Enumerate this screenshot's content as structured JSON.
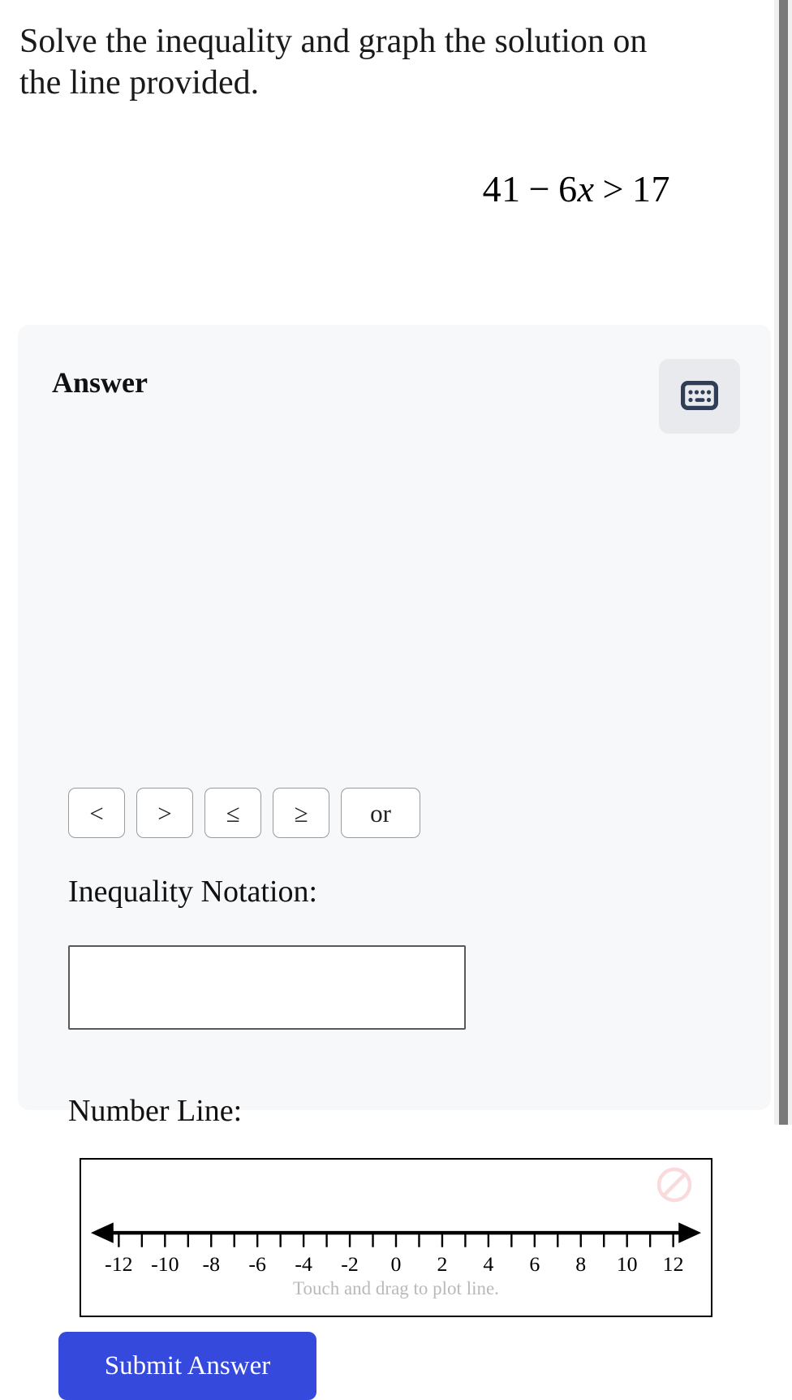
{
  "question": {
    "text": "Solve the inequality and graph the solution on the line provided.",
    "equation": {
      "lhs_number": "41",
      "minus": "−",
      "coefficient": "6",
      "variable": "x",
      "relation": ">",
      "rhs_number": "17",
      "full": "41 − 6x > 17"
    }
  },
  "answer_panel": {
    "title": "Answer",
    "keyboard_button": {
      "icon": "keyboard-icon",
      "color": "#2f3d56"
    },
    "operators": [
      {
        "label": "<",
        "name": "less-than"
      },
      {
        "label": ">",
        "name": "greater-than"
      },
      {
        "label": "≤",
        "name": "less-than-or-equal"
      },
      {
        "label": "≥",
        "name": "greater-than-or-equal"
      },
      {
        "label": "or",
        "name": "or-keyword"
      }
    ],
    "inequality_notation": {
      "label": "Inequality Notation:",
      "value": "",
      "placeholder": ""
    },
    "number_line": {
      "label": "Number Line:",
      "hint": "Touch and drag to plot line.",
      "clear_icon": "prohibition-icon",
      "clear_icon_color": "#fadbdd",
      "tick_labels": [
        "-12",
        "-10",
        "-8",
        "-6",
        "-4",
        "-2",
        "0",
        "2",
        "4",
        "6",
        "8",
        "10",
        "12"
      ],
      "min": -13,
      "max": 13,
      "tick_step": 1,
      "label_step": 2,
      "left_arrow": true,
      "right_arrow": true,
      "plotted_segments": []
    },
    "submit_label": "Submit Answer",
    "submit_color": "#3549dd"
  },
  "chrome": {
    "scrollbar_thumb_color": "#7a7a7a"
  }
}
